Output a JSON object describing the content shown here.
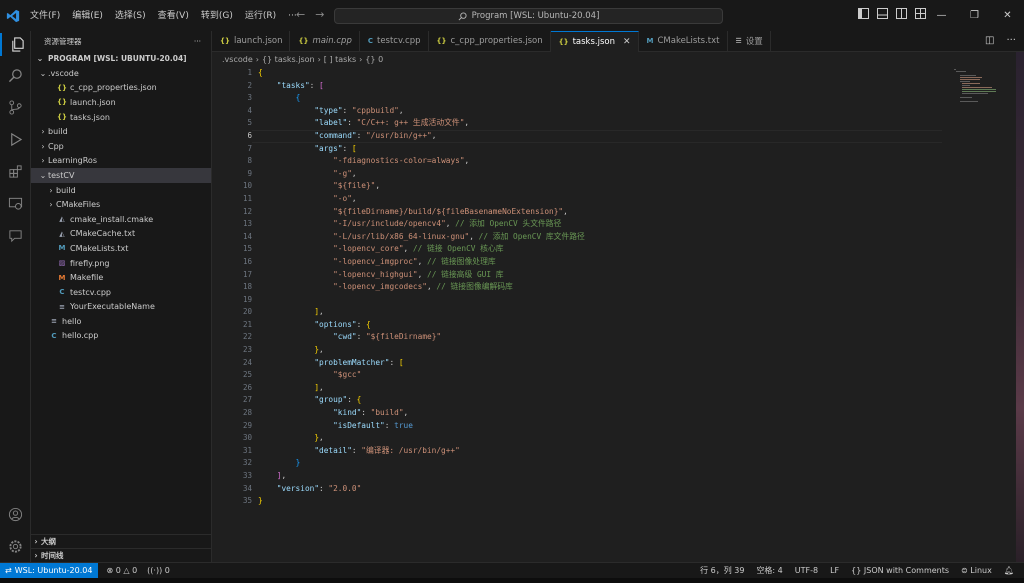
{
  "menu": [
    "文件(F)",
    "编辑(E)",
    "选择(S)",
    "查看(V)",
    "转到(G)",
    "运行(R)",
    "···"
  ],
  "search": {
    "label": "Program [WSL: Ubuntu-20.04]"
  },
  "sidebar": {
    "title": "资源管理器",
    "root": "PROGRAM [WSL: UBUNTU-20.04]",
    "items": [
      {
        "label": ".vscode",
        "type": "folder-open",
        "depth": 1
      },
      {
        "label": "c_cpp_properties.json",
        "type": "json",
        "depth": 2
      },
      {
        "label": "launch.json",
        "type": "json",
        "depth": 2
      },
      {
        "label": "tasks.json",
        "type": "json",
        "depth": 2
      },
      {
        "label": "build",
        "type": "folder",
        "depth": 1
      },
      {
        "label": "Cpp",
        "type": "folder",
        "depth": 1
      },
      {
        "label": "LearningRos",
        "type": "folder",
        "depth": 1
      },
      {
        "label": "testCV",
        "type": "folder-open",
        "depth": 1,
        "selected": true
      },
      {
        "label": "build",
        "type": "folder",
        "depth": 2
      },
      {
        "label": "CMakeFiles",
        "type": "folder",
        "depth": 2
      },
      {
        "label": "cmake_install.cmake",
        "type": "cmake",
        "depth": 2
      },
      {
        "label": "CMakeCache.txt",
        "type": "cmake",
        "depth": 2
      },
      {
        "label": "CMakeLists.txt",
        "type": "m",
        "depth": 2
      },
      {
        "label": "firefly.png",
        "type": "image",
        "depth": 2
      },
      {
        "label": "Makefile",
        "type": "m-orange",
        "depth": 2
      },
      {
        "label": "testcv.cpp",
        "type": "cpp",
        "depth": 2
      },
      {
        "label": "YourExecutableName",
        "type": "file",
        "depth": 2
      },
      {
        "label": "hello",
        "type": "file",
        "depth": 1
      },
      {
        "label": "hello.cpp",
        "type": "cpp",
        "depth": 1
      }
    ],
    "outline": "大纲",
    "timeline": "时间线"
  },
  "tabs": [
    {
      "label": "launch.json",
      "icon": "json",
      "active": false,
      "italic": false
    },
    {
      "label": "main.cpp",
      "icon": "json",
      "active": false,
      "italic": true
    },
    {
      "label": "testcv.cpp",
      "icon": "cpp",
      "active": false,
      "italic": false
    },
    {
      "label": "c_cpp_properties.json",
      "icon": "json",
      "active": false,
      "italic": false
    },
    {
      "label": "tasks.json",
      "icon": "json",
      "active": true,
      "italic": false
    },
    {
      "label": "CMakeLists.txt",
      "icon": "m",
      "active": false,
      "italic": false
    },
    {
      "label": "设置",
      "icon": "settings",
      "active": false,
      "italic": false
    }
  ],
  "breadcrumb": [
    ".vscode",
    "{} tasks.json",
    "[ ] tasks",
    "{} 0"
  ],
  "editor": {
    "current_line": 6,
    "lines": [
      [
        [
          "b1",
          "{"
        ]
      ],
      [
        [
          "p",
          "    "
        ],
        [
          "k",
          "\"tasks\""
        ],
        [
          "p",
          ": "
        ],
        [
          "b2",
          "["
        ]
      ],
      [
        [
          "p",
          "        "
        ],
        [
          "b3",
          "{"
        ]
      ],
      [
        [
          "p",
          "            "
        ],
        [
          "k",
          "\"type\""
        ],
        [
          "p",
          ": "
        ],
        [
          "s",
          "\"cppbuild\""
        ],
        [
          "p",
          ","
        ]
      ],
      [
        [
          "p",
          "            "
        ],
        [
          "k",
          "\"label\""
        ],
        [
          "p",
          ": "
        ],
        [
          "s",
          "\"C/C++: g++ 生成活动文件\""
        ],
        [
          "p",
          ","
        ]
      ],
      [
        [
          "p",
          "            "
        ],
        [
          "k",
          "\"command\""
        ],
        [
          "p",
          ": "
        ],
        [
          "s",
          "\"/usr/bin/g++\""
        ],
        [
          "p",
          ","
        ]
      ],
      [
        [
          "p",
          "            "
        ],
        [
          "k",
          "\"args\""
        ],
        [
          "p",
          ": "
        ],
        [
          "b1",
          "["
        ]
      ],
      [
        [
          "p",
          "                "
        ],
        [
          "s",
          "\"-fdiagnostics-color=always\""
        ],
        [
          "p",
          ","
        ]
      ],
      [
        [
          "p",
          "                "
        ],
        [
          "s",
          "\"-g\""
        ],
        [
          "p",
          ","
        ]
      ],
      [
        [
          "p",
          "                "
        ],
        [
          "s",
          "\"${file}\""
        ],
        [
          "p",
          ","
        ]
      ],
      [
        [
          "p",
          "                "
        ],
        [
          "s",
          "\"-o\""
        ],
        [
          "p",
          ","
        ]
      ],
      [
        [
          "p",
          "                "
        ],
        [
          "s",
          "\"${fileDirname}/build/${fileBasenameNoExtension}\""
        ],
        [
          "p",
          ","
        ]
      ],
      [
        [
          "p",
          "                "
        ],
        [
          "s",
          "\"-I/usr/include/opencv4\""
        ],
        [
          "p",
          ", "
        ],
        [
          "c",
          "// 添加 OpenCV 头文件路径"
        ]
      ],
      [
        [
          "p",
          "                "
        ],
        [
          "s",
          "\"-L/usr/lib/x86_64-linux-gnu\""
        ],
        [
          "p",
          ", "
        ],
        [
          "c",
          "// 添加 OpenCV 库文件路径"
        ]
      ],
      [
        [
          "p",
          "                "
        ],
        [
          "s",
          "\"-lopencv_core\""
        ],
        [
          "p",
          ", "
        ],
        [
          "c",
          "// 链接 OpenCV 核心库"
        ]
      ],
      [
        [
          "p",
          "                "
        ],
        [
          "s",
          "\"-lopencv_imgproc\""
        ],
        [
          "p",
          ", "
        ],
        [
          "c",
          "// 链接图像处理库"
        ]
      ],
      [
        [
          "p",
          "                "
        ],
        [
          "s",
          "\"-lopencv_highgui\""
        ],
        [
          "p",
          ", "
        ],
        [
          "c",
          "// 链接高级 GUI 库"
        ]
      ],
      [
        [
          "p",
          "                "
        ],
        [
          "s",
          "\"-lopencv_imgcodecs\""
        ],
        [
          "p",
          ", "
        ],
        [
          "c",
          "// 链接图像编解码库"
        ]
      ],
      [
        [
          "p",
          ""
        ]
      ],
      [
        [
          "p",
          "            "
        ],
        [
          "b1",
          "]"
        ],
        [
          "p",
          ","
        ]
      ],
      [
        [
          "p",
          "            "
        ],
        [
          "k",
          "\"options\""
        ],
        [
          "p",
          ": "
        ],
        [
          "b1",
          "{"
        ]
      ],
      [
        [
          "p",
          "                "
        ],
        [
          "k",
          "\"cwd\""
        ],
        [
          "p",
          ": "
        ],
        [
          "s",
          "\"${fileDirname}\""
        ]
      ],
      [
        [
          "p",
          "            "
        ],
        [
          "b1",
          "}"
        ],
        [
          "p",
          ","
        ]
      ],
      [
        [
          "p",
          "            "
        ],
        [
          "k",
          "\"problemMatcher\""
        ],
        [
          "p",
          ": "
        ],
        [
          "b1",
          "["
        ]
      ],
      [
        [
          "p",
          "                "
        ],
        [
          "s",
          "\"$gcc\""
        ]
      ],
      [
        [
          "p",
          "            "
        ],
        [
          "b1",
          "]"
        ],
        [
          "p",
          ","
        ]
      ],
      [
        [
          "p",
          "            "
        ],
        [
          "k",
          "\"group\""
        ],
        [
          "p",
          ": "
        ],
        [
          "b1",
          "{"
        ]
      ],
      [
        [
          "p",
          "                "
        ],
        [
          "k",
          "\"kind\""
        ],
        [
          "p",
          ": "
        ],
        [
          "s",
          "\"build\""
        ],
        [
          "p",
          ","
        ]
      ],
      [
        [
          "p",
          "                "
        ],
        [
          "k",
          "\"isDefault\""
        ],
        [
          "p",
          ": "
        ],
        [
          "t",
          "true"
        ]
      ],
      [
        [
          "p",
          "            "
        ],
        [
          "b1",
          "}"
        ],
        [
          "p",
          ","
        ]
      ],
      [
        [
          "p",
          "            "
        ],
        [
          "k",
          "\"detail\""
        ],
        [
          "p",
          ": "
        ],
        [
          "s",
          "\"编译器: /usr/bin/g++\""
        ]
      ],
      [
        [
          "p",
          "        "
        ],
        [
          "b3",
          "}"
        ]
      ],
      [
        [
          "p",
          "    "
        ],
        [
          "b2",
          "]"
        ],
        [
          "p",
          ","
        ]
      ],
      [
        [
          "p",
          "    "
        ],
        [
          "k",
          "\"version\""
        ],
        [
          "p",
          ": "
        ],
        [
          "s",
          "\"2.0.0\""
        ]
      ],
      [
        [
          "b1",
          "}"
        ]
      ]
    ]
  },
  "status": {
    "remote": "WSL: Ubuntu-20.04",
    "errors": "0",
    "warnings": "0",
    "ports": "0",
    "position": "行 6，列 39",
    "spaces": "空格: 4",
    "encoding": "UTF-8",
    "eol": "LF",
    "language": "JSON with Comments",
    "os": "Linux"
  },
  "colors": {
    "accent": "#0078d4",
    "background": "#1f1f1f",
    "sidebar": "#181818"
  }
}
